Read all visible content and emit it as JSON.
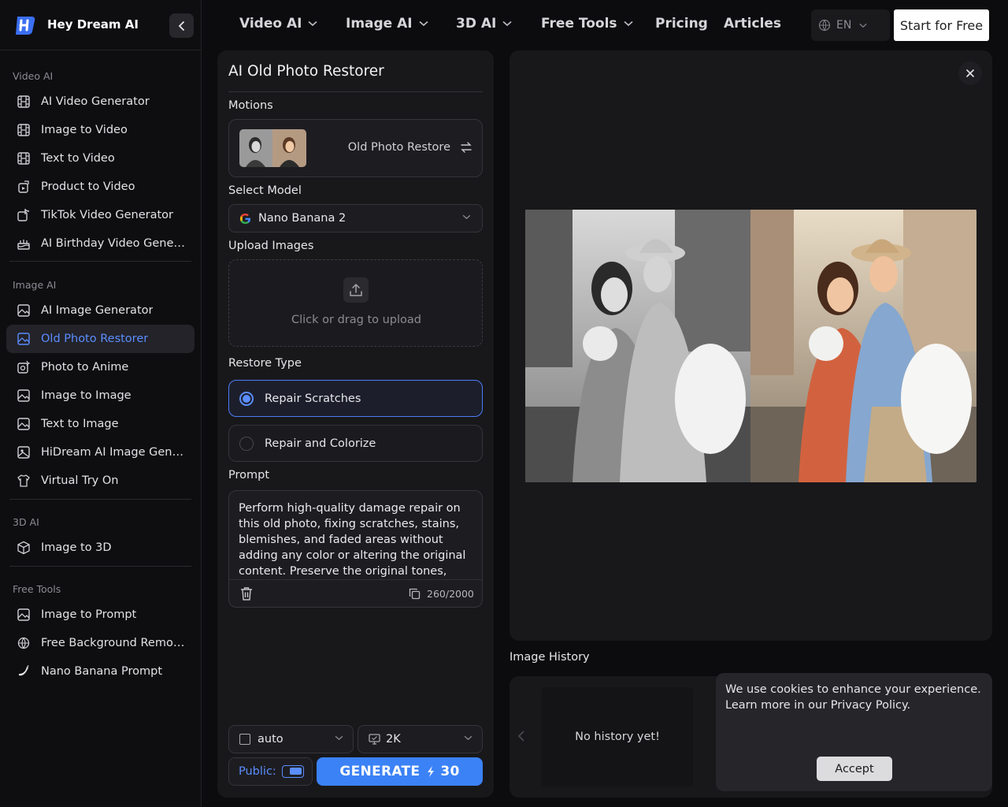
{
  "brand": {
    "name": "Hey Dream AI",
    "logo_icon": "hey-dream-logo",
    "accent": "#3b82f6"
  },
  "sidebar": {
    "sections": [
      {
        "title": "Video AI",
        "items": [
          {
            "label": "AI Video Generator",
            "icon": "film-icon"
          },
          {
            "label": "Image to Video",
            "icon": "film-icon"
          },
          {
            "label": "Text to Video",
            "icon": "film-icon"
          },
          {
            "label": "Product to Video",
            "icon": "product-video-icon"
          },
          {
            "label": "TikTok Video Generator",
            "icon": "tiktok-icon"
          },
          {
            "label": "AI Birthday Video Generator",
            "icon": "cake-icon"
          }
        ]
      },
      {
        "title": "Image AI",
        "items": [
          {
            "label": "AI Image Generator",
            "icon": "image-icon"
          },
          {
            "label": "Old Photo Restorer",
            "icon": "image-icon",
            "active": true
          },
          {
            "label": "Photo to Anime",
            "icon": "anime-icon"
          },
          {
            "label": "Image to Image",
            "icon": "image-icon"
          },
          {
            "label": "Text to Image",
            "icon": "image-icon"
          },
          {
            "label": "HiDream AI Image Generator",
            "icon": "photo-icon"
          },
          {
            "label": "Virtual Try On",
            "icon": "shirt-icon"
          }
        ]
      },
      {
        "title": "3D AI",
        "items": [
          {
            "label": "Image to 3D",
            "icon": "cube-icon"
          }
        ]
      },
      {
        "title": "Free Tools",
        "items": [
          {
            "label": "Image to Prompt",
            "icon": "image-icon"
          },
          {
            "label": "Free Background Remover",
            "icon": "globe-layers-icon"
          },
          {
            "label": "Nano Banana Prompt",
            "icon": "banana-icon"
          }
        ]
      }
    ]
  },
  "topnav": {
    "items": [
      {
        "label": "Video AI",
        "dropdown": true
      },
      {
        "label": "Image AI",
        "dropdown": true
      },
      {
        "label": "3D AI",
        "dropdown": true
      },
      {
        "label": "Free Tools",
        "dropdown": true
      },
      {
        "label": "Pricing",
        "dropdown": false
      },
      {
        "label": "Articles",
        "dropdown": false
      }
    ],
    "language": "EN",
    "start_button": "Start for Free"
  },
  "form": {
    "title": "AI Old Photo Restorer",
    "motions_label": "Motions",
    "motion_name": "Old Photo Restore",
    "model_label": "Select Model",
    "model_value": "Nano Banana 2",
    "upload_label": "Upload Images",
    "upload_text": "Click or drag to upload",
    "restore_type_label": "Restore Type",
    "restore_options": [
      {
        "label": "Repair Scratches",
        "selected": true
      },
      {
        "label": "Repair and Colorize",
        "selected": false
      }
    ],
    "prompt_label": "Prompt",
    "prompt_text": "Perform high-quality damage repair on this old photo, fixing scratches, stains, blemishes, and faded areas without adding any color or altering the original content. Preserve the original tones,",
    "char_count": "260/2000",
    "aspect_value": "auto",
    "resolution_value": "2K",
    "public_label": "Public:",
    "public_on": true,
    "generate_label": "GENERATE",
    "generate_cost": "30"
  },
  "preview": {
    "history_label": "Image History",
    "history_empty": "No history yet!"
  },
  "cookie": {
    "text": "We use cookies to enhance your experience. Learn more in our Privacy Policy.",
    "accept": "Accept"
  }
}
